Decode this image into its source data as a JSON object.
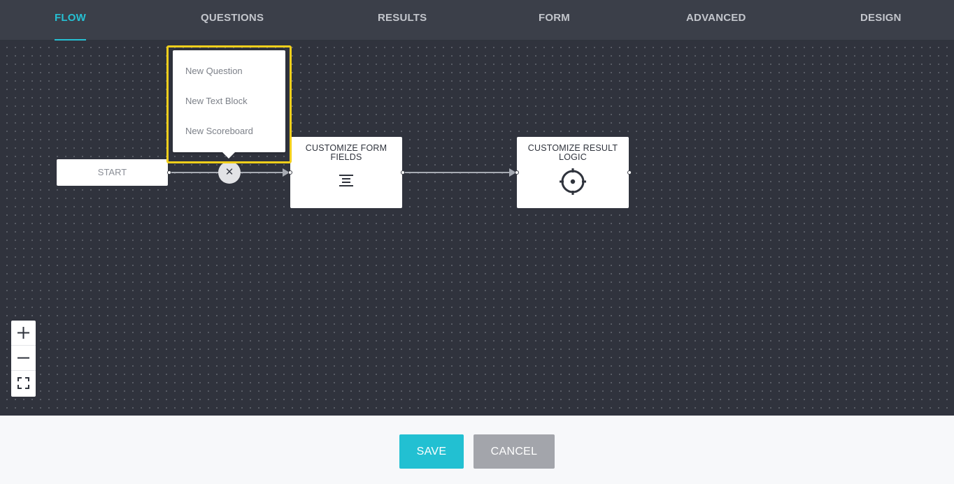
{
  "nav": {
    "tabs": [
      {
        "label": "FLOW",
        "active": true
      },
      {
        "label": "QUESTIONS",
        "active": false
      },
      {
        "label": "RESULTS",
        "active": false
      },
      {
        "label": "FORM",
        "active": false
      },
      {
        "label": "ADVANCED",
        "active": false
      },
      {
        "label": "DESIGN",
        "active": false
      }
    ]
  },
  "canvas": {
    "start_node": {
      "label": "START"
    },
    "add_button": {
      "icon": "close-icon",
      "glyph": "✕"
    },
    "popup_menu": {
      "items": [
        {
          "label": "New Question"
        },
        {
          "label": "New Text Block"
        },
        {
          "label": "New Scoreboard"
        }
      ]
    },
    "nodes": [
      {
        "title": "CUSTOMIZE FORM FIELDS",
        "icon": "align-center-icon"
      },
      {
        "title": "CUSTOMIZE RESULT LOGIC",
        "icon": "target-icon"
      }
    ],
    "zoom_controls": {
      "zoom_in": {
        "icon": "plus-icon"
      },
      "zoom_out": {
        "icon": "minus-icon"
      },
      "fit": {
        "icon": "fullscreen-icon"
      }
    }
  },
  "footer": {
    "save_label": "SAVE",
    "cancel_label": "CANCEL"
  },
  "colors": {
    "accent": "#26c0d3",
    "highlight": "#f2cf1b",
    "canvas": "#30333d",
    "nav": "#3b3f49",
    "cancel": "#a3a5ab"
  }
}
